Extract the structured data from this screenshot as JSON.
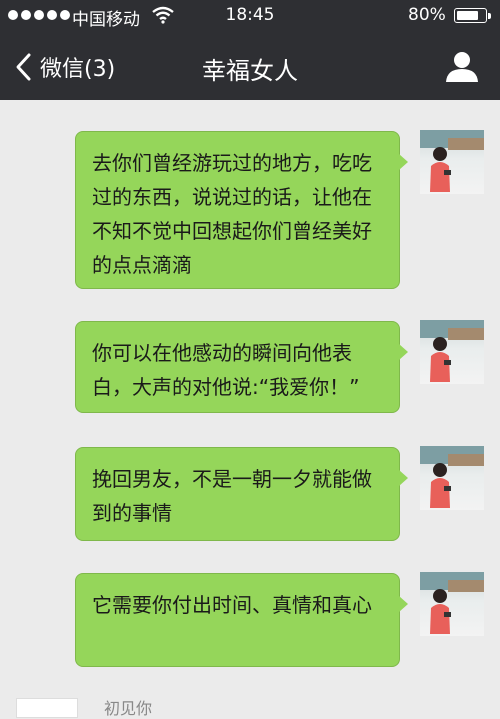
{
  "status": {
    "carrier": "中国移动",
    "time": "18:45",
    "battery": "80%",
    "battery_level": 0.8
  },
  "nav": {
    "back_label": "微信(3)",
    "title": "幸福女人"
  },
  "messages": [
    {
      "text": "去你们曾经游玩过的地方，吃吃过的东西，说说过的话，让他在不知不觉中回想起你们曾经美好的点点滴滴"
    },
    {
      "text": "你可以在他感动的瞬间向他表白，大声的对他说:“我爱你！”"
    },
    {
      "text": "挽回男友，不是一朝一夕就能做到的事情"
    },
    {
      "text": "它需要你付出时间、真情和真心"
    }
  ],
  "incoming": {
    "name": "初见你"
  },
  "colors": {
    "bar": "#2e2f33",
    "chat_bg": "#ebebeb",
    "bubble": "#95d65a"
  },
  "icons": {
    "back": "chevron-left-icon",
    "profile": "person-icon",
    "wifi": "wifi-icon",
    "battery": "battery-icon"
  }
}
